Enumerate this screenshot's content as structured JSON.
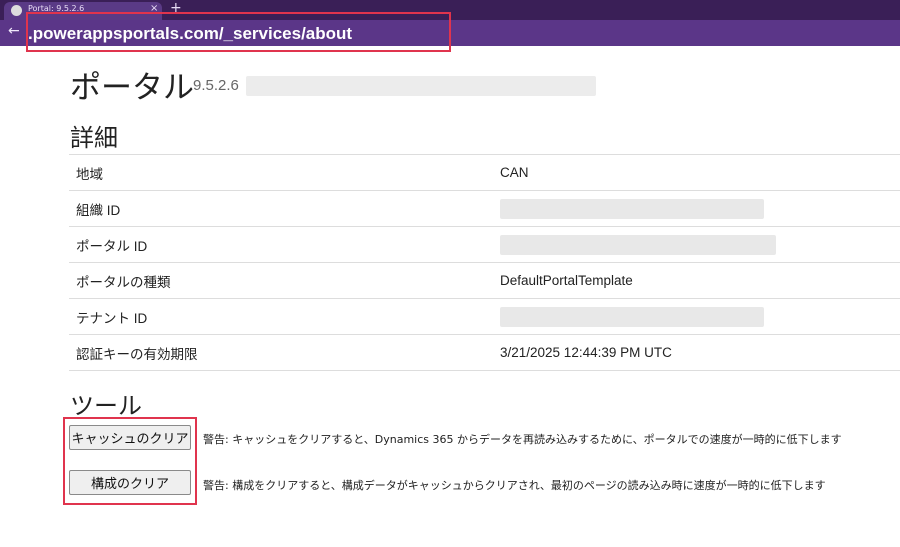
{
  "browser": {
    "tab_title": "Portal: 9.5.2.6",
    "tab_close": "×",
    "new_tab": "+",
    "back": "←",
    "url": ".powerappsportals.com/_services/about"
  },
  "page": {
    "title": "ポータル",
    "version": "9.5.2.6"
  },
  "details": {
    "heading": "詳細",
    "rows": [
      {
        "label": "地域",
        "value": "CAN"
      },
      {
        "label": "組織 ID",
        "value": ""
      },
      {
        "label": "ポータル ID",
        "value": ""
      },
      {
        "label": "ポータルの種類",
        "value": "DefaultPortalTemplate"
      },
      {
        "label": "テナント ID",
        "value": ""
      },
      {
        "label": "認証キーの有効期限",
        "value": "3/21/2025 12:44:39 PM UTC"
      }
    ]
  },
  "tools": {
    "heading": "ツール",
    "clear_cache_label": "キャッシュのクリア",
    "clear_cache_warning": "警告: キャッシュをクリアすると、Dynamics 365 からデータを再読み込みするために、ポータルでの速度が一時的に低下します",
    "clear_config_label": "構成のクリア",
    "clear_config_warning": "警告: 構成をクリアすると、構成データがキャッシュからクリアされ、最初のページの読み込み時に速度が一時的に低下します"
  },
  "colors": {
    "browser_frame": "#3a1f57",
    "address_bar": "#5b3688",
    "highlight_border": "#e0344d"
  }
}
